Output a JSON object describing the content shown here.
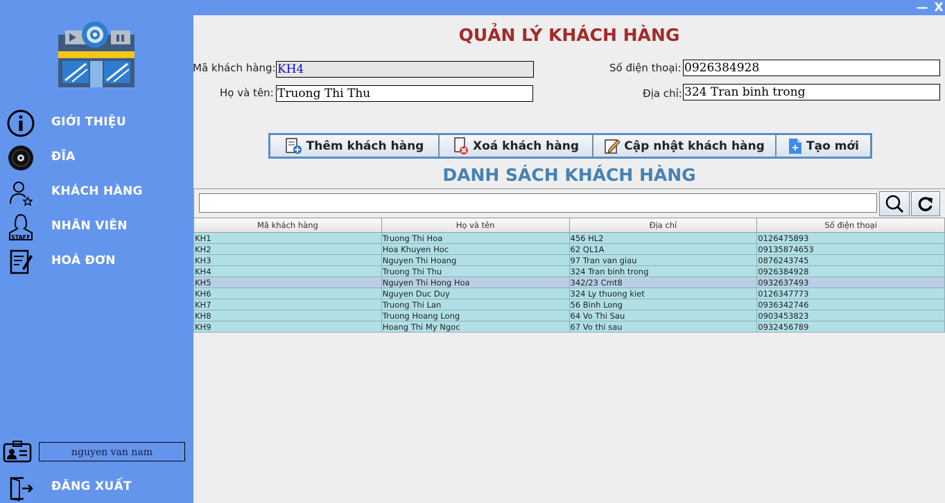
{
  "window": {
    "minimize": "—",
    "close": "X"
  },
  "sidebar": {
    "items": [
      {
        "label": "GIỚI THIỆU",
        "icon": "info-icon"
      },
      {
        "label": "ĐĨA",
        "icon": "disc-icon"
      },
      {
        "label": "KHÁCH HÀNG",
        "icon": "customer-icon"
      },
      {
        "label": "NHÂN VIÊN",
        "icon": "staff-icon"
      },
      {
        "label": "HOÁ ĐƠN",
        "icon": "invoice-icon"
      }
    ],
    "username": "nguyen van nam",
    "logout": "ĐĂNG XUẤT"
  },
  "main": {
    "title": "QUẢN LÝ KHÁCH HÀNG",
    "form": {
      "id_label": "Mã khách hàng:",
      "id_value": "KH4",
      "name_label": "Họ và tên:",
      "name_value": "Truong Thi Thu",
      "phone_label": "Số điện thoại:",
      "phone_value": "0926384928",
      "address_label": "Địa chỉ:",
      "address_value": "324 Tran binh trong"
    },
    "buttons": {
      "add": "Thêm khách hàng",
      "delete": "Xoá khách hàng",
      "update": "Cập nhật khách hàng",
      "new": "Tạo mới"
    },
    "list_title": "DANH SÁCH KHÁCH HÀNG",
    "search": {
      "value": ""
    },
    "table": {
      "headers": [
        "Mã khách hàng",
        "Họ và tên",
        "Địa chỉ",
        "Số điện thoại"
      ],
      "rows": [
        [
          "KH1",
          "Truong Thi Hoa",
          "456 HL2",
          "0126475893"
        ],
        [
          "KH2",
          "Hoa Khuyen Hoc",
          "62 QL1A",
          "09135874653"
        ],
        [
          "KH3",
          "Nguyen Thi Hoang",
          "97 Tran van giau",
          "0876243745"
        ],
        [
          "KH4",
          "Truong Thi Thu",
          "324 Tran binh trong",
          "0926384928"
        ],
        [
          "KH5",
          "Nguyen Thi Hong Hoa",
          "342/23 Cmt8",
          "0932637493"
        ],
        [
          "KH6",
          "Nguyen Duc Duy",
          "324 Ly thuong kiet",
          "0126347773"
        ],
        [
          "KH7",
          "Truong Thi Lan",
          "56 Binh Long",
          "0936342746"
        ],
        [
          "KH8",
          "Truong Hoang Long",
          "64 Vo Thi Sau",
          "0903453823"
        ],
        [
          "KH9",
          "Hoang Thi My Ngoc",
          "67 Vo thi sau",
          "0932456789"
        ]
      ],
      "selected_row": 4
    }
  }
}
